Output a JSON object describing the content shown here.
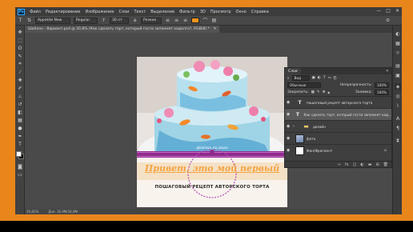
{
  "menubar": {
    "logo": "Ps",
    "items": [
      "Файл",
      "Редактирование",
      "Изображение",
      "Слои",
      "Текст",
      "Выделение",
      "Фильтр",
      "3D",
      "Просмотр",
      "Окно",
      "Справка"
    ],
    "win_min": "—",
    "win_max": "□",
    "win_close": "✕"
  },
  "options": {
    "font_family": "Appetite New",
    "font_style": "Regular",
    "font_size": "30 пт",
    "antialias": "Резкое",
    "text_color": "#f7941e"
  },
  "doc_tab": {
    "title": "Шаблон - Вариант.psd @ 20,8% (Как сделать торт, который гости запомнят надолго?, RGB/8) *",
    "close": "✕"
  },
  "canvas": {
    "headline": "Привет, это мой первый",
    "subtitle": "ПОШАГОВЫЙ РЕЦЕПТ АВТОРСКОГО ТОРТА",
    "watermark": "@kuhnya_na_vkuse"
  },
  "statusbar": {
    "zoom": "20,81%",
    "doc_size": "Док: 16,9M/34,9M"
  },
  "layers_panel": {
    "tab_label": "Слои",
    "close": "✕",
    "kind_label": "Вид",
    "blend_mode": "Обычные",
    "opacity_label": "Непрозрачность:",
    "opacity_value": "100%",
    "lock_label": "Закрепить:",
    "fill_label": "Заливка:",
    "fill_value": "100%",
    "layers": [
      {
        "name": "пошаговый рецепт авторского торта",
        "type": "text",
        "selected": false
      },
      {
        "name": "Как сделать торт, который гости запомнят над...",
        "type": "text",
        "selected": true
      },
      {
        "name": "дизайн",
        "type": "folder",
        "selected": false
      },
      {
        "name": "фото",
        "type": "photo",
        "selected": false
      },
      {
        "name": "Фон/Фрагмент",
        "type": "background",
        "selected": false
      }
    ]
  },
  "colors": {
    "frame": "#e8851b",
    "app_bg": "#535353",
    "accent_purple": "#8e2a8c",
    "headline_color": "#f4a340"
  }
}
